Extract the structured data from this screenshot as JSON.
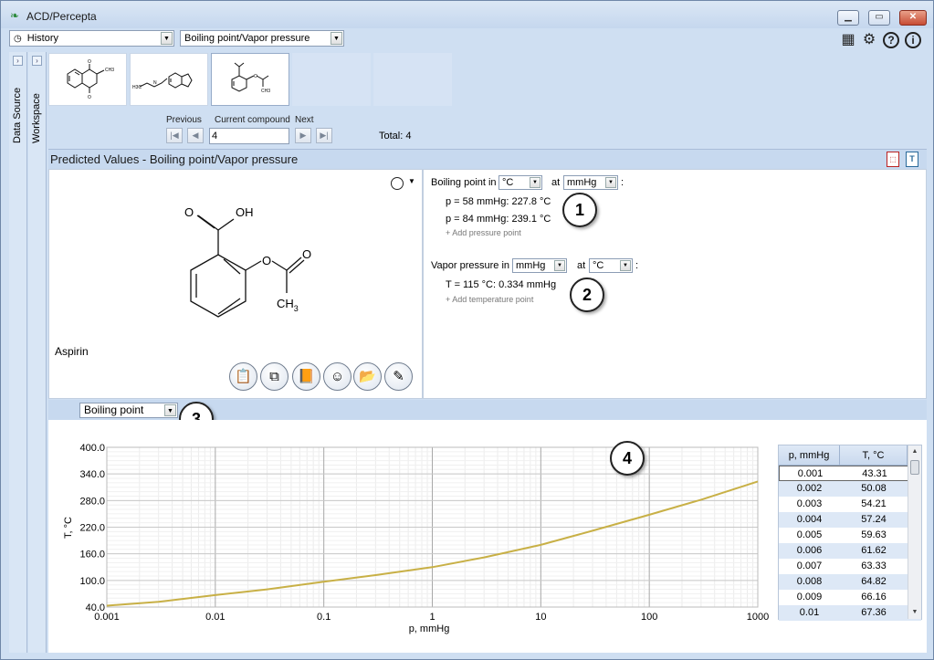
{
  "window": {
    "title": "ACD/Percepta",
    "minimize_icon": "minimize-icon",
    "maximize_icon": "maximize-icon",
    "close_icon": "close-icon"
  },
  "toolbar": {
    "history_label": "History",
    "property_label": "Boiling point/Vapor pressure",
    "icons": [
      "calculator-icon",
      "gear-icon",
      "help-icon",
      "info-icon"
    ]
  },
  "side_tabs": {
    "data_source": "Data Source",
    "workspace": "Workspace"
  },
  "navigator": {
    "previous_label": "Previous",
    "current_label": "Current compound",
    "next_label": "Next",
    "current_value": "4",
    "total_text": "Total: 4"
  },
  "predicted": {
    "title": "Predicted Values - Boiling point/Vapor pressure",
    "compound_name": "Aspirin",
    "boiling": {
      "label_prefix": "Boiling point in",
      "unit": "°C",
      "at_label": "at",
      "pressure_unit": "mmHg",
      "colon": ":",
      "values": [
        "p = 58 mmHg: 227.8 °C",
        "p = 84 mmHg: 239.1 °C"
      ],
      "add_link": "+ Add pressure point"
    },
    "vapor": {
      "label_prefix": "Vapor pressure in",
      "unit": "mmHg",
      "at_label": "at",
      "temp_unit": "°C",
      "colon": ":",
      "values": [
        "T = 115 °C: 0.334 mmHg"
      ],
      "add_link": "+ Add temperature point"
    },
    "callouts": [
      "1",
      "2",
      "3",
      "4"
    ],
    "structure_labels": {
      "o1": "O",
      "oh": "OH",
      "o2": "O",
      "o3": "O",
      "ch3": "CH",
      "ch3_sub": "3"
    }
  },
  "actions": [
    "clipboard-icon",
    "copy-structure-icon",
    "book-icon",
    "smiley-icon",
    "open-folder-icon",
    "pencil-icon"
  ],
  "plot_selector": "Boiling point",
  "chart_data": {
    "type": "line",
    "xlabel": "p, mmHg",
    "ylabel": "T, °C",
    "x_scale": "log",
    "xlim": [
      0.001,
      1000
    ],
    "ylim": [
      40,
      400
    ],
    "xticks": [
      "0.001",
      "0.01",
      "0.1",
      "1",
      "10",
      "100",
      "1000"
    ],
    "yticks": [
      "40.0",
      "100.0",
      "160.0",
      "220.0",
      "280.0",
      "340.0",
      "400.0"
    ],
    "grid": true,
    "line_color": "#c8b046",
    "series": [
      {
        "x": [
          0.001,
          0.003,
          0.01,
          0.03,
          0.1,
          0.3,
          1,
          3,
          10,
          30,
          100,
          300,
          1000
        ],
        "y": [
          43,
          52,
          67,
          80,
          97,
          112,
          130,
          152,
          180,
          212,
          248,
          282,
          323
        ]
      }
    ]
  },
  "table": {
    "headers": [
      "p, mmHg",
      "T, °C"
    ],
    "rows": [
      [
        "0.001",
        "43.31"
      ],
      [
        "0.002",
        "50.08"
      ],
      [
        "0.003",
        "54.21"
      ],
      [
        "0.004",
        "57.24"
      ],
      [
        "0.005",
        "59.63"
      ],
      [
        "0.006",
        "61.62"
      ],
      [
        "0.007",
        "63.33"
      ],
      [
        "0.008",
        "64.82"
      ],
      [
        "0.009",
        "66.16"
      ],
      [
        "0.01",
        "67.36"
      ]
    ]
  }
}
